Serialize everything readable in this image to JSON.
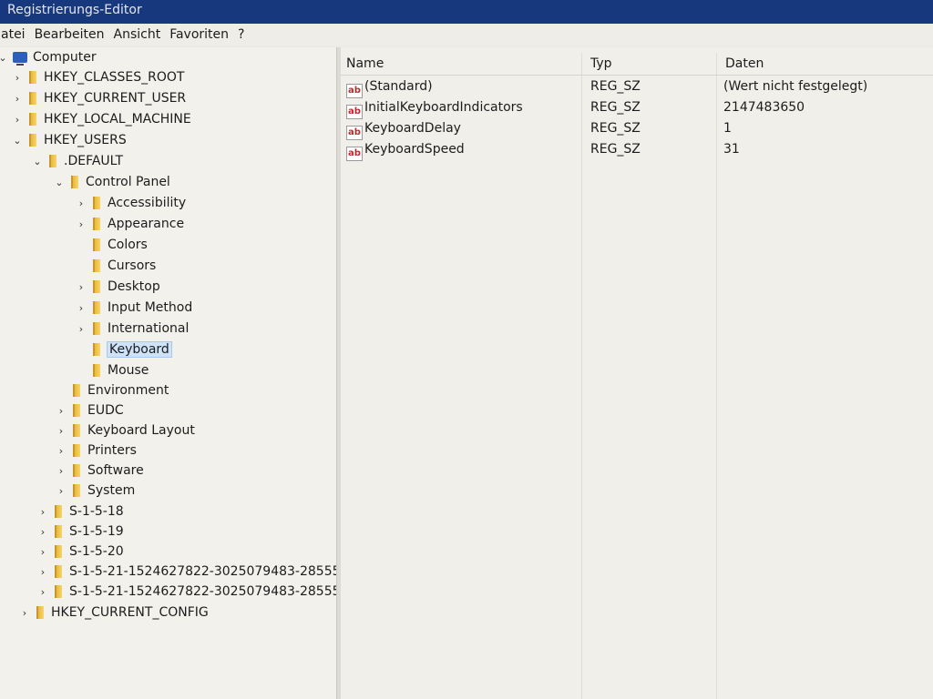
{
  "window": {
    "title": "Registrierungs-Editor"
  },
  "menu": [
    "atei",
    "Bearbeiten",
    "Ansicht",
    "Favoriten",
    "?"
  ],
  "tree": [
    {
      "label": "Computer",
      "expanded": true,
      "root": true
    },
    {
      "label": "HKEY_CLASSES_ROOT"
    },
    {
      "label": "HKEY_CURRENT_USER"
    },
    {
      "label": "HKEY_LOCAL_MACHINE"
    },
    {
      "label": "HKEY_USERS",
      "expanded": true
    },
    {
      "label": ".DEFAULT",
      "expanded": true
    },
    {
      "label": "Control Panel",
      "expanded": true
    },
    {
      "label": "Accessibility"
    },
    {
      "label": "Appearance"
    },
    {
      "label": "Colors"
    },
    {
      "label": "Cursors"
    },
    {
      "label": "Desktop"
    },
    {
      "label": "Input Method"
    },
    {
      "label": "International"
    },
    {
      "label": "Keyboard",
      "selected": true
    },
    {
      "label": "Mouse"
    },
    {
      "label": "Environment"
    },
    {
      "label": "EUDC"
    },
    {
      "label": "Keyboard Layout"
    },
    {
      "label": "Printers"
    },
    {
      "label": "Software"
    },
    {
      "label": "System"
    },
    {
      "label": "S-1-5-18"
    },
    {
      "label": "S-1-5-19"
    },
    {
      "label": "S-1-5-20"
    },
    {
      "label": "S-1-5-21-1524627822-3025079483-28555"
    },
    {
      "label": "S-1-5-21-1524627822-3025079483-28555"
    },
    {
      "label": "HKEY_CURRENT_CONFIG"
    }
  ],
  "columns": {
    "name": "Name",
    "type": "Typ",
    "data": "Daten"
  },
  "values": [
    {
      "icon": "string-value-icon",
      "icon_text": "ab",
      "name": "(Standard)",
      "type": "REG_SZ",
      "data": "(Wert nicht festgelegt)"
    },
    {
      "icon": "string-value-icon",
      "icon_text": "ab",
      "name": "InitialKeyboardIndicators",
      "type": "REG_SZ",
      "data": "2147483650"
    },
    {
      "icon": "string-value-icon",
      "icon_text": "ab",
      "name": "KeyboardDelay",
      "type": "REG_SZ",
      "data": "1"
    },
    {
      "icon": "string-value-icon",
      "icon_text": "ab",
      "name": "KeyboardSpeed",
      "type": "REG_SZ",
      "data": "31"
    }
  ]
}
